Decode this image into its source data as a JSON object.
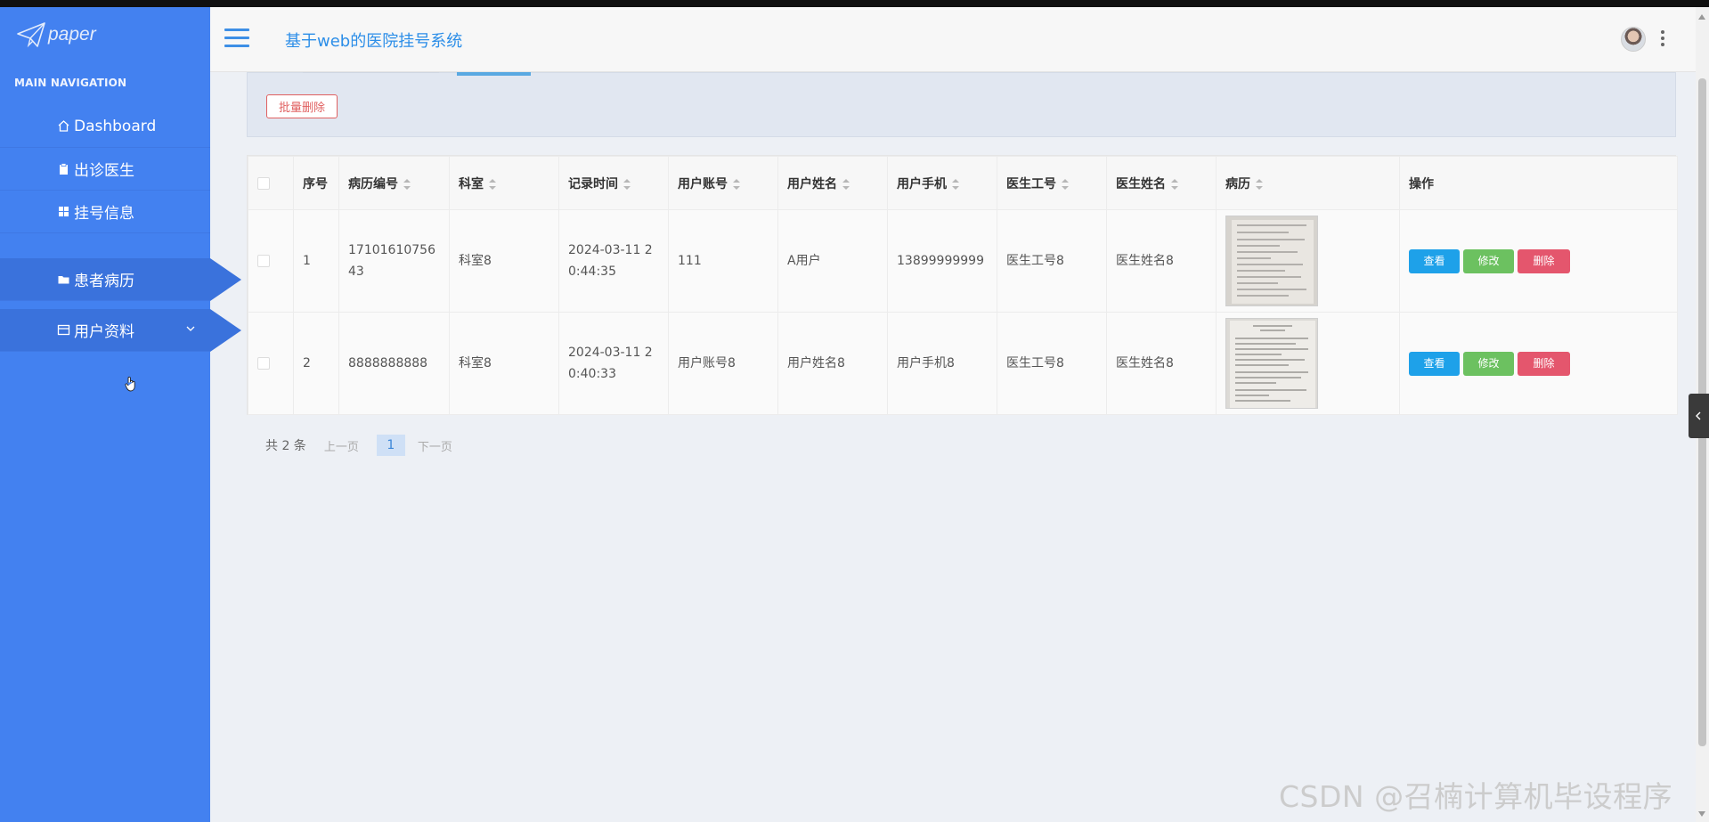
{
  "brand": {
    "name": "paper"
  },
  "sidebar": {
    "heading": "MAIN NAVIGATION",
    "items": [
      {
        "label": "Dashboard",
        "icon": "home-icon"
      },
      {
        "label": "出诊医生",
        "icon": "clipboard-icon"
      },
      {
        "label": "挂号信息",
        "icon": "grid-icon"
      },
      {
        "label": "患者病历",
        "icon": "folder-icon",
        "active": true
      },
      {
        "label": "用户资料",
        "icon": "card-icon",
        "expandable": true
      }
    ]
  },
  "header": {
    "title": "基于web的医院挂号系统"
  },
  "toolbar": {
    "batch_delete": "批量删除"
  },
  "table": {
    "headers": [
      "序号",
      "病历编号",
      "科室",
      "记录时间",
      "用户账号",
      "用户姓名",
      "用户手机",
      "医生工号",
      "医生姓名",
      "病历",
      "操作"
    ],
    "rows": [
      {
        "index": "1",
        "record_no": "1710161075643",
        "department": "科室8",
        "time": "2024-03-11 20:44:35",
        "account": "111",
        "user_name": "A用户",
        "phone": "13899999999",
        "doctor_no": "医生工号8",
        "doctor_name": "医生姓名8"
      },
      {
        "index": "2",
        "record_no": "8888888888",
        "department": "科室8",
        "time": "2024-03-11 20:40:33",
        "account": "用户账号8",
        "user_name": "用户姓名8",
        "phone": "用户手机8",
        "doctor_no": "医生工号8",
        "doctor_name": "医生姓名8"
      }
    ],
    "actions": {
      "view": "查看",
      "edit": "修改",
      "delete": "删除"
    }
  },
  "pagination": {
    "total": "共 2 条",
    "prev": "上一页",
    "current": "1",
    "next": "下一页"
  },
  "watermark": "CSDN @召楠计算机毕设程序",
  "colors": {
    "sidebar": "#4381f0",
    "active": "#3a72dc",
    "view": "#1ea1e9",
    "edit": "#6cc160",
    "delete": "#e4566d",
    "title": "#2c8ee8"
  }
}
